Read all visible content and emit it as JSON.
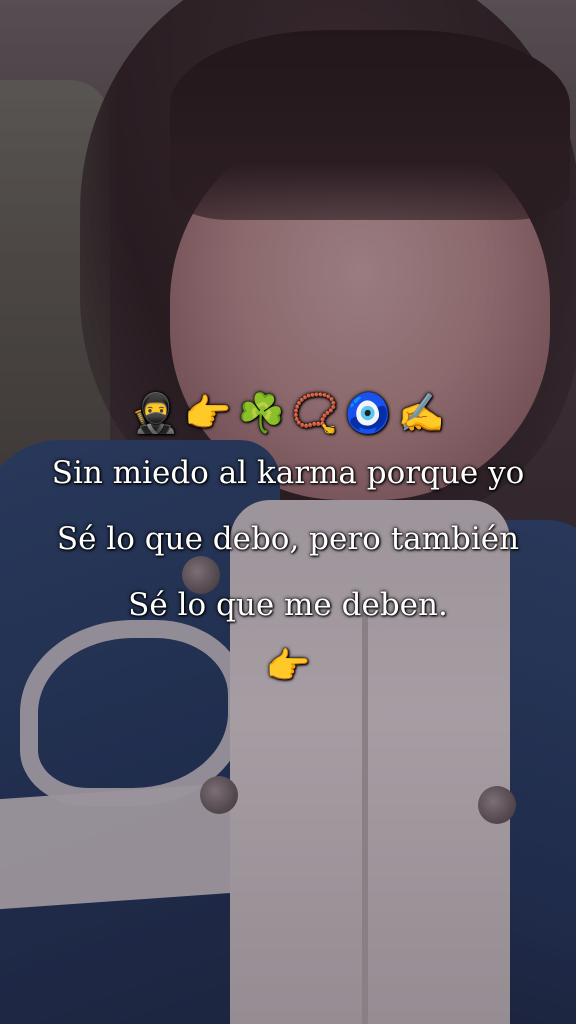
{
  "caption": {
    "emoji_row": [
      "🥷",
      "👉",
      "☘️",
      "📿",
      "🧿",
      "✍️"
    ],
    "lines": [
      "Sin miedo al karma porque yo",
      "Sé lo que debo, pero también",
      "Sé lo que me deben."
    ],
    "trailing_emoji": "👉"
  }
}
